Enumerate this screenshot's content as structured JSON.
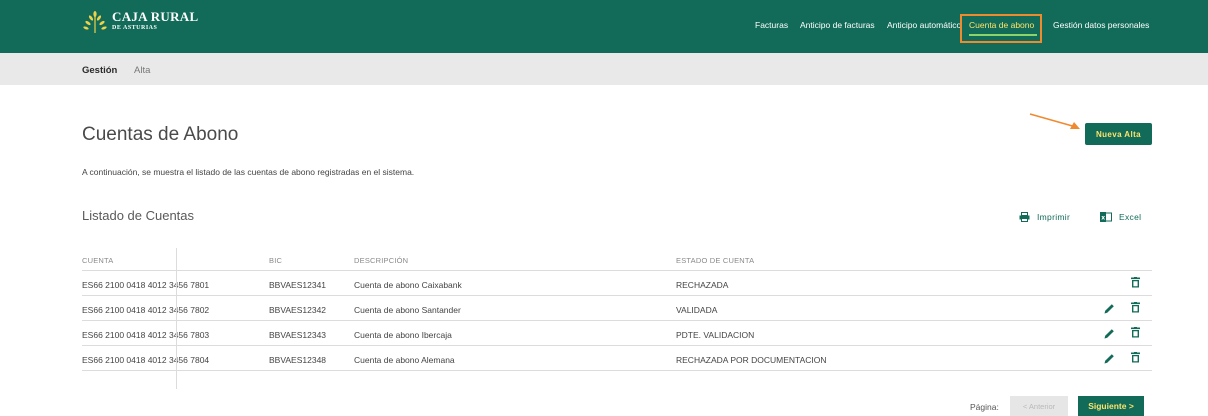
{
  "brand": {
    "line1": "CAJA RURAL",
    "line2": "DE ASTURIAS",
    "logo_color": "#f0d24a"
  },
  "topnav": {
    "items": [
      {
        "label": "Facturas"
      },
      {
        "label": "Anticipo de facturas"
      },
      {
        "label": "Anticipo automático"
      },
      {
        "label": "Cuenta de abono",
        "active": true
      },
      {
        "label": "Gestión datos personales"
      }
    ]
  },
  "subnav": {
    "items": [
      {
        "label": "Gestión",
        "active": true
      },
      {
        "label": "Alta"
      }
    ]
  },
  "page": {
    "title": "Cuentas de Abono",
    "intro": "A continuación, se muestra el listado de las cuentas de abono registradas en el sistema.",
    "new_button": "Nueva Alta"
  },
  "list": {
    "title": "Listado de Cuentas",
    "print_label": "Imprimir",
    "excel_label": "Excel",
    "columns": [
      "CUENTA",
      "BIC",
      "DESCRIPCIÓN",
      "ESTADO DE CUENTA"
    ],
    "rows": [
      {
        "cuenta": "ES66 2100 0418 4012 3456 7801",
        "bic": "BBVAES12341",
        "descripcion": "Cuenta de abono Caixabank",
        "estado": "RECHAZADA",
        "editable": false
      },
      {
        "cuenta": "ES66 2100 0418 4012 3456 7802",
        "bic": "BBVAES12342",
        "descripcion": "Cuenta de abono Santander",
        "estado": "VALIDADA",
        "editable": true
      },
      {
        "cuenta": "ES66 2100 0418 4012 3456 7803",
        "bic": "BBVAES12343",
        "descripcion": "Cuenta de abono Ibercaja",
        "estado": "PDTE. VALIDACION",
        "editable": true
      },
      {
        "cuenta": "ES66 2100 0418 4012 3456 7804",
        "bic": "BBVAES12348",
        "descripcion": "Cuenta de abono Alemana",
        "estado": "RECHAZADA POR DOCUMENTACION",
        "editable": true
      }
    ]
  },
  "pager": {
    "label": "Página:",
    "prev": "< Anterior",
    "next": "Siguiente >"
  },
  "colors": {
    "brand_green": "#116b58",
    "accent_yellow": "#ffe36a",
    "highlight_orange": "#f08a2e",
    "active_underline": "#8bd46a"
  }
}
